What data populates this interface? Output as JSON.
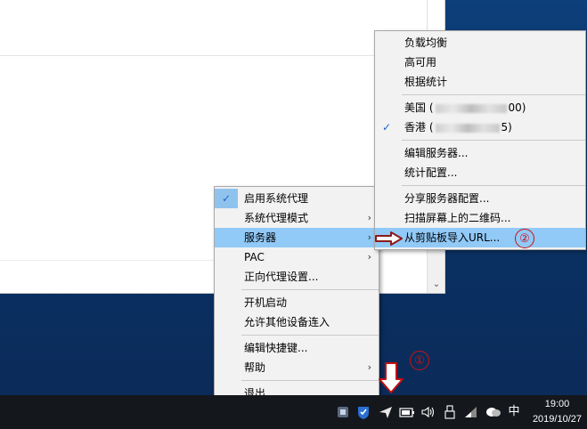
{
  "main_menu": {
    "items": [
      {
        "label": "启用系统代理",
        "checked": true
      },
      {
        "label": "系统代理模式",
        "submenu": true
      },
      {
        "label": "服务器",
        "submenu": true,
        "highlighted": true
      },
      {
        "label": "PAC",
        "submenu": true
      },
      {
        "label": "正向代理设置..."
      },
      {
        "label": "开机启动"
      },
      {
        "label": "允许其他设备连入"
      },
      {
        "label": "编辑快捷键..."
      },
      {
        "label": "帮助",
        "submenu": true
      },
      {
        "label": "退出"
      }
    ]
  },
  "server_menu": {
    "items": [
      {
        "label": "负载均衡"
      },
      {
        "label": "高可用"
      },
      {
        "label": "根据统计"
      },
      {
        "label_prefix": "美国 (",
        "label_suffix": "00)"
      },
      {
        "label_prefix": "香港 (",
        "label_suffix": "5)",
        "checked": true
      },
      {
        "label": "编辑服务器..."
      },
      {
        "label": "统计配置..."
      },
      {
        "label": "分享服务器配置..."
      },
      {
        "label": "扫描屏幕上的二维码..."
      },
      {
        "label": "从剪贴板导入URL...",
        "highlighted": true
      }
    ]
  },
  "annotations": {
    "step1": "①",
    "step2": "②",
    "color": "#d01010"
  },
  "taskbar": {
    "ime": "中",
    "time": "19:00",
    "date": "2019/10/27"
  },
  "icons": {
    "check": "✓",
    "submenu_arrow": "›",
    "scroll_down": "⌄",
    "tray": [
      "shield-icon",
      "security-icon",
      "paper-plane-icon",
      "battery-icon",
      "speaker-icon",
      "usb-icon",
      "wifi-icon",
      "chat-icon"
    ]
  },
  "colors": {
    "highlight": "#91c9f7",
    "menu_bg": "#f2f2f2",
    "taskbar": "#14171c",
    "desktop": "#0a3266"
  }
}
